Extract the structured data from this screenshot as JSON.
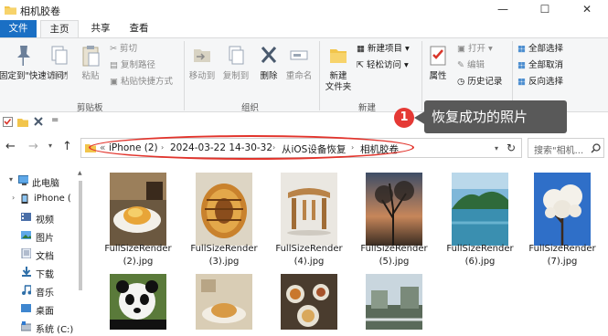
{
  "window": {
    "title": "相机胶卷",
    "minimize": "—",
    "maximize": "☐",
    "close": "✕"
  },
  "tabs": [
    "文件",
    "主页",
    "共享",
    "查看"
  ],
  "ribbon": {
    "clipboard": {
      "pin": "固定到\"快速访问\"",
      "copy": "复制",
      "paste": "粘贴",
      "cut": "剪切",
      "copy_path": "复制路径",
      "paste_shortcut": "粘贴快捷方式",
      "group": "剪贴板"
    },
    "organize": {
      "move_to": "移动到",
      "copy_to": "复制到",
      "delete": "删除",
      "rename": "重命名",
      "group": "组织"
    },
    "new": {
      "new_folder": "新建\n文件夹",
      "new_item": "新建项目",
      "easy_access": "轻松访问",
      "group": "新建"
    },
    "open": {
      "properties": "属性",
      "open": "打开",
      "edit": "编辑",
      "history": "历史记录",
      "group": "打开"
    },
    "select": {
      "select_all": "全部选择",
      "select_none": "全部取消",
      "invert": "反向选择",
      "group": "选择"
    }
  },
  "qat": {
    "dropdown": "="
  },
  "address": {
    "back": "←",
    "forward": "→",
    "up": "↑",
    "overflow": "«",
    "crumbs": [
      "iPhone (2)",
      "2024-03-22 14-30-32",
      "从iOS设备恢复",
      "相机胶卷"
    ],
    "refresh": "↻",
    "search_placeholder": "搜索\"相机..."
  },
  "nav": [
    {
      "label": "此电脑",
      "icon": "computer-icon"
    },
    {
      "label": "iPhone (",
      "icon": "phone-icon"
    },
    {
      "label": "视频",
      "icon": "video-folder-icon"
    },
    {
      "label": "图片",
      "icon": "pictures-folder-icon"
    },
    {
      "label": "文档",
      "icon": "documents-folder-icon"
    },
    {
      "label": "下载",
      "icon": "downloads-folder-icon"
    },
    {
      "label": "音乐",
      "icon": "music-folder-icon"
    },
    {
      "label": "桌面",
      "icon": "desktop-folder-icon"
    },
    {
      "label": "系统 (C:)",
      "icon": "drive-icon"
    }
  ],
  "files": [
    {
      "name": "FullSizeRender (2).jpg",
      "line1": "FullSizeRender",
      "line2": "(2).jpg"
    },
    {
      "name": "FullSizeRender (3).jpg",
      "line1": "FullSizeRender",
      "line2": "(3).jpg"
    },
    {
      "name": "FullSizeRender (4).jpg",
      "line1": "FullSizeRender",
      "line2": "(4).jpg"
    },
    {
      "name": "FullSizeRender (5).jpg",
      "line1": "FullSizeRender",
      "line2": "(5).jpg"
    },
    {
      "name": "FullSizeRender (6).jpg",
      "line1": "FullSizeRender",
      "line2": "(6).jpg"
    },
    {
      "name": "FullSizeRender (7).jpg",
      "line1": "FullSizeRender",
      "line2": "(7).jpg"
    }
  ],
  "annotation": {
    "badge": "1",
    "callout": "恢复成功的照片"
  },
  "colors": {
    "accent": "#1a6fc4",
    "highlight": "#e2342c",
    "callout_bg": "#595959"
  }
}
